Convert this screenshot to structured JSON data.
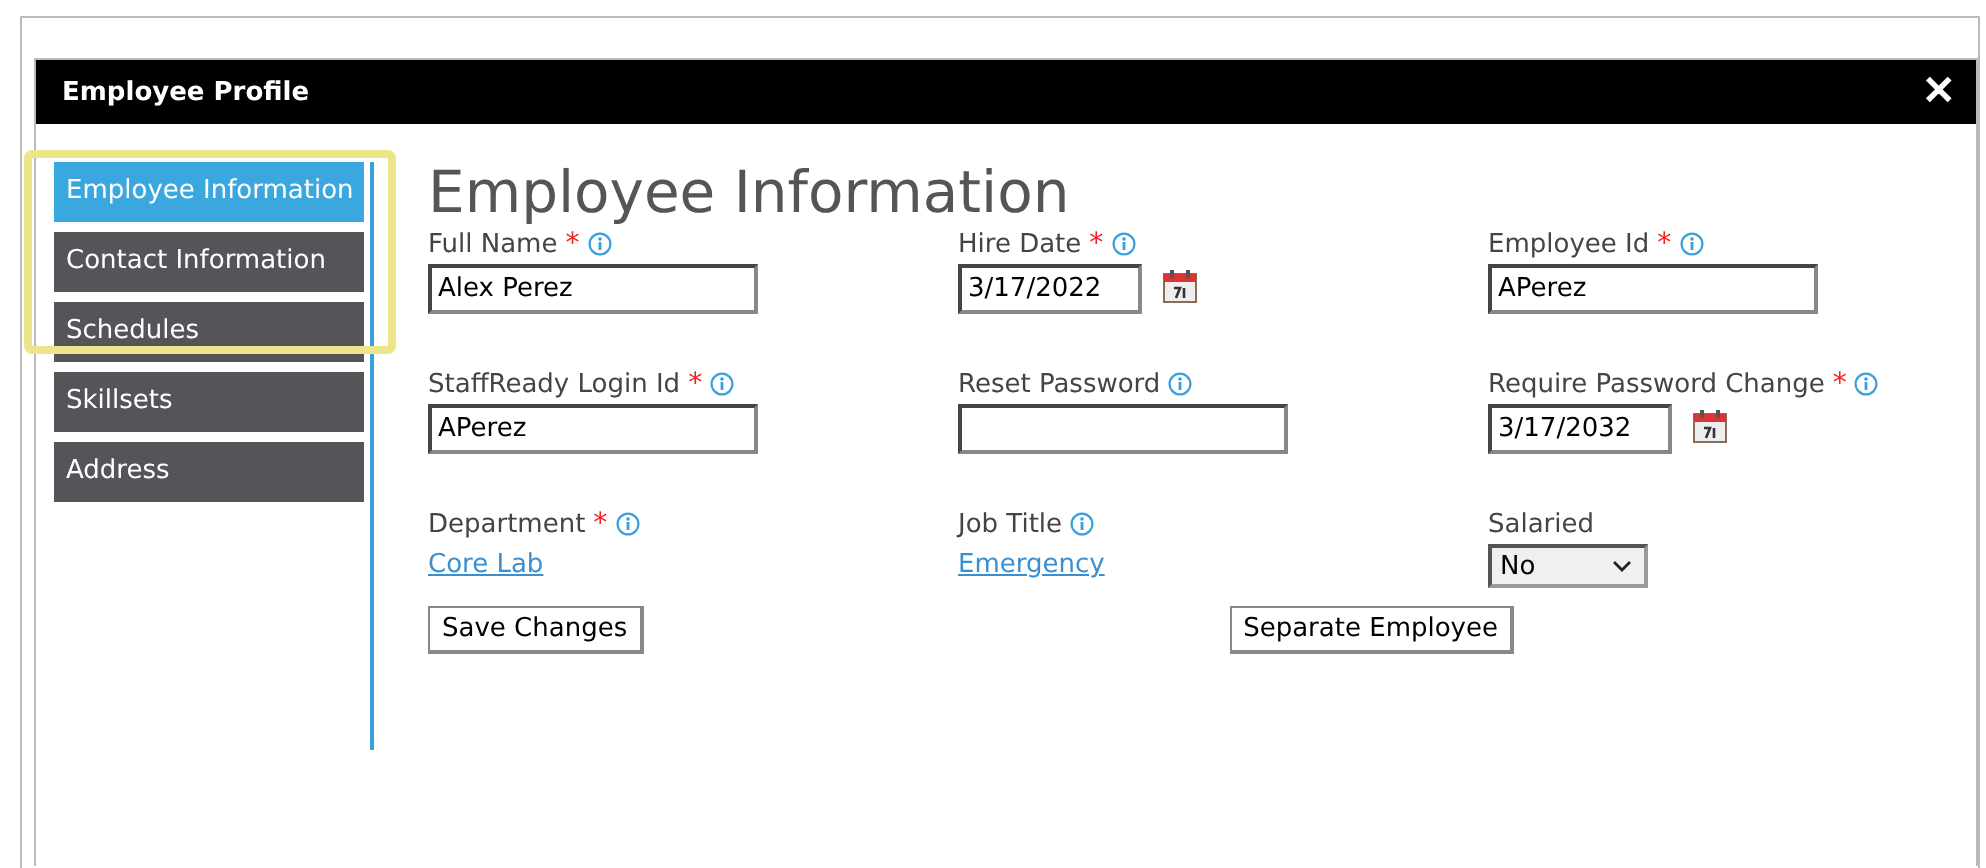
{
  "window": {
    "title": "Employee Profile",
    "close": "✕"
  },
  "sidebar": {
    "items": [
      {
        "label": "Employee Information",
        "selected": true
      },
      {
        "label": "Contact Information",
        "selected": false
      },
      {
        "label": "Schedules",
        "selected": false
      },
      {
        "label": "Skillsets",
        "selected": false
      },
      {
        "label": "Address",
        "selected": false
      }
    ]
  },
  "heading": "Employee Information",
  "fields": [
    {
      "label": "Full Name",
      "required_mark": "*",
      "info": true,
      "kind": "text",
      "value": "Alex Perez"
    },
    {
      "label": "Hire Date",
      "required_mark": "*",
      "info": true,
      "kind": "date",
      "value": "3/17/2022"
    },
    {
      "label": "Employee Id",
      "required_mark": "*",
      "info": true,
      "kind": "text",
      "value": "APerez"
    },
    {
      "label": "StaffReady Login Id",
      "required_mark": "*",
      "info": true,
      "kind": "text",
      "value": "APerez"
    },
    {
      "label": "Reset Password",
      "info": true,
      "kind": "text"
    },
    {
      "label": "Require Password Change",
      "required_mark": "*",
      "info": true,
      "kind": "date",
      "value": "3/17/2032"
    },
    {
      "label": "Department",
      "required_mark": "*",
      "info": true,
      "kind": "link",
      "value": "Core Lab"
    },
    {
      "label": "Job Title",
      "info": true,
      "kind": "link",
      "value": "Emergency"
    },
    {
      "label": "Salaried",
      "info": false,
      "kind": "select",
      "value": "No"
    }
  ],
  "buttons": [
    "Save Changes",
    "Separate Employee"
  ]
}
